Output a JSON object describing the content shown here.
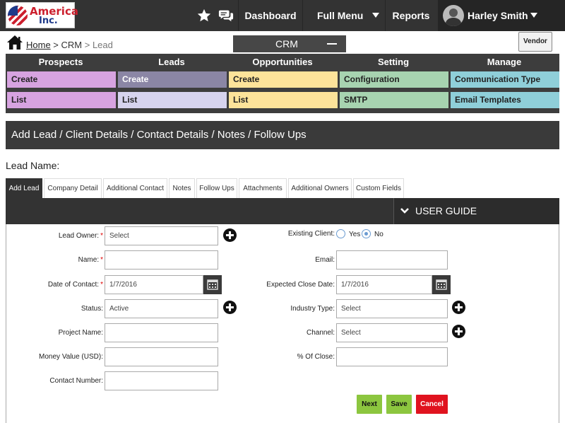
{
  "topbar": {
    "logo": {
      "line1": "America",
      "line2": "Inc."
    },
    "icons": [
      "star-icon",
      "chat-icon"
    ],
    "nav": {
      "dashboard": "Dashboard",
      "full_menu": "Full Menu",
      "reports": "Reports"
    },
    "user_name": "Harley Smith"
  },
  "breadcrumb": {
    "home": "Home",
    "sep1": " > ",
    "crm": "CRM",
    "sep2": " > ",
    "current": "Lead"
  },
  "crm_tab": "CRM",
  "vendor_button": "Vendor",
  "menu": {
    "columns": [
      {
        "title": "Prospects",
        "items": [
          {
            "label": "Create",
            "color": "#d7a3e0"
          },
          {
            "label": "List",
            "color": "#d7a3e0"
          }
        ]
      },
      {
        "title": "Leads",
        "items": [
          {
            "label": "Create",
            "color": "#8b86a5"
          },
          {
            "label": "List",
            "color": "#d6d3ee"
          }
        ]
      },
      {
        "title": "Opportunities",
        "items": [
          {
            "label": "Create",
            "color": "#fde39a"
          },
          {
            "label": "List",
            "color": "#fde39a"
          }
        ]
      },
      {
        "title": "Setting",
        "items": [
          {
            "label": "Configuration",
            "color": "#a7d3b0"
          },
          {
            "label": "SMTP",
            "color": "#a7d3b0"
          }
        ]
      },
      {
        "title": "Manage",
        "items": [
          {
            "label": "Communication Type",
            "color": "#8fcfd9"
          },
          {
            "label": "Email Templates",
            "color": "#8fcfd9"
          }
        ]
      }
    ]
  },
  "page_header": "Add Lead / Client Details / Contact Details / Notes / Follow Ups",
  "lead_name_label": "Lead Name:",
  "tabs": [
    "Add Lead",
    "Company Detail",
    "Additional Contact",
    "Notes",
    "Follow Ups",
    "Attachments",
    "Additional Owners",
    "Custom Fields"
  ],
  "active_tab": "Add Lead",
  "user_guide": "USER GUIDE",
  "form": {
    "lead_owner": {
      "label": "Lead Owner:",
      "value": "Select"
    },
    "name": {
      "label": "Name:",
      "value": ""
    },
    "date_of_contact": {
      "label": "Date of Contact:",
      "value": "1/7/2016"
    },
    "status": {
      "label": "Status:",
      "value": "Active"
    },
    "project_name": {
      "label": "Project Name:",
      "value": ""
    },
    "money_value": {
      "label": "Money Value (USD):",
      "value": ""
    },
    "contact_number": {
      "label": "Contact Number:",
      "value": ""
    },
    "existing_client": {
      "label": "Existing Client:",
      "yes": "Yes",
      "no": "No",
      "selected": "No"
    },
    "email": {
      "label": "Email:",
      "value": ""
    },
    "expected_close_date": {
      "label": "Expected Close Date:",
      "value": "1/7/2016"
    },
    "industry_type": {
      "label": "Industry Type:",
      "value": "Select"
    },
    "channel": {
      "label": "Channel:",
      "value": "Select"
    },
    "percent_close": {
      "label": "% Of Close:",
      "value": ""
    },
    "required_mark": "*"
  },
  "buttons": {
    "next": {
      "label": "Next",
      "color": "#8cc63f"
    },
    "save": {
      "label": "Save",
      "color": "#8cc63f"
    },
    "cancel": {
      "label": "Cancel",
      "color": "#e0131f"
    }
  }
}
